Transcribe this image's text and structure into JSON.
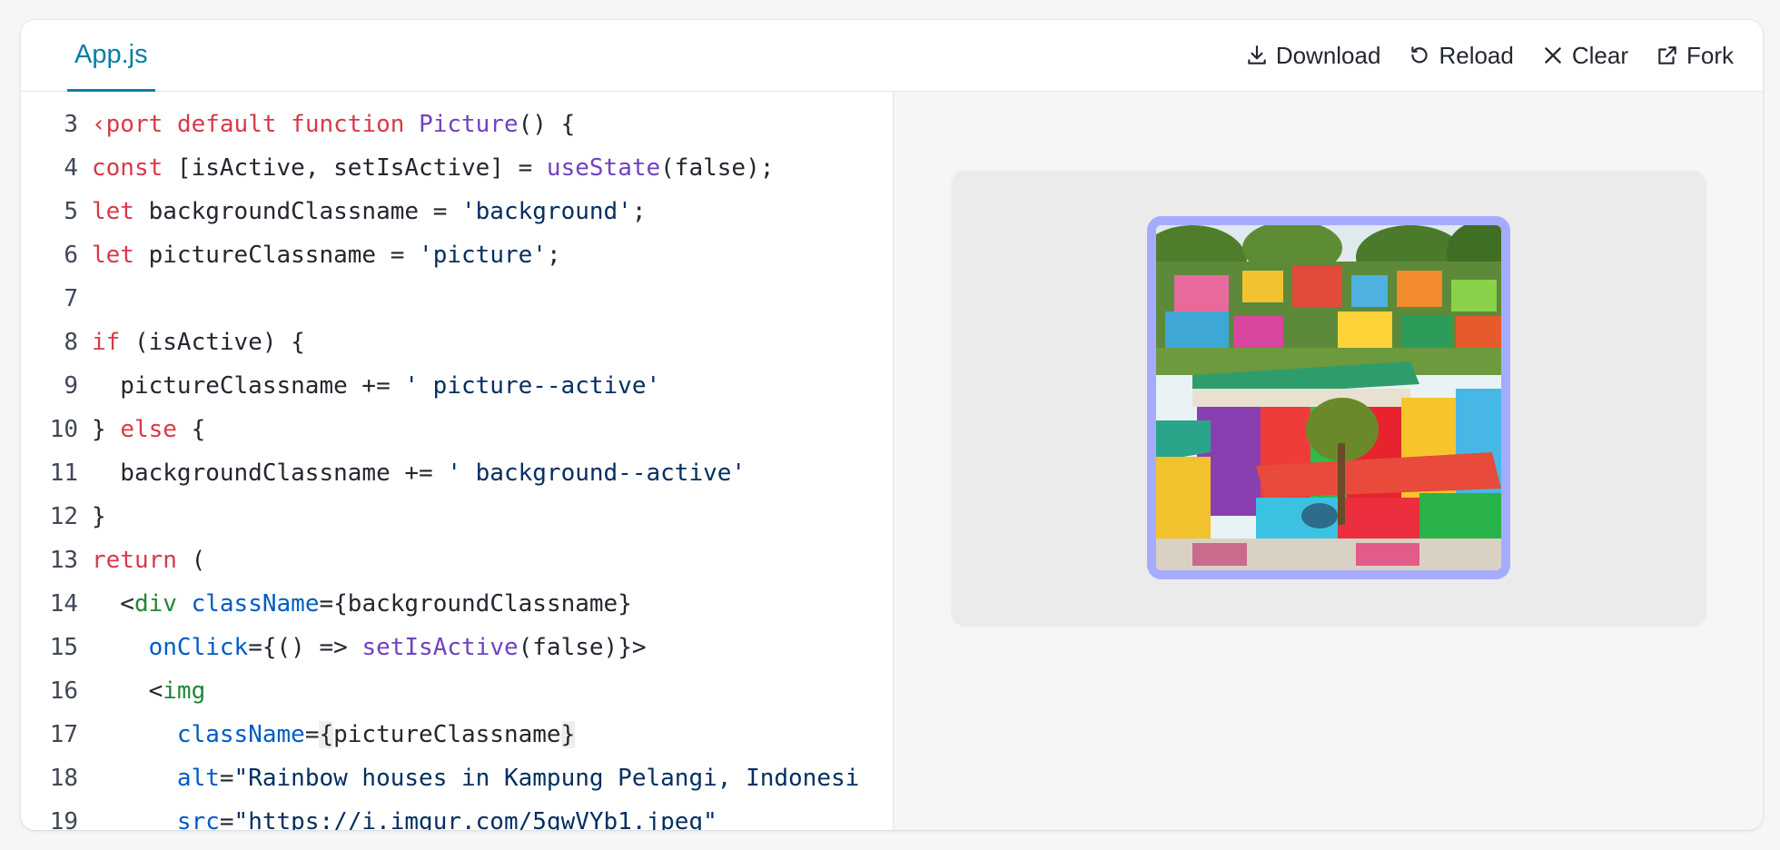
{
  "tab": {
    "filename": "App.js"
  },
  "toolbar": {
    "download": "Download",
    "reload": "Reload",
    "clear": "Clear",
    "fork": "Fork"
  },
  "code": {
    "lines": [
      {
        "n": "3",
        "tokens": [
          {
            "t": "‹port",
            "c": "kw"
          },
          {
            "t": " "
          },
          {
            "t": "default",
            "c": "kw"
          },
          {
            "t": " "
          },
          {
            "t": "function",
            "c": "kw"
          },
          {
            "t": " "
          },
          {
            "t": "Picture",
            "c": "fn"
          },
          {
            "t": "() {"
          }
        ]
      },
      {
        "n": "4",
        "tokens": [
          {
            "t": "const",
            "c": "kw"
          },
          {
            "t": " [isActive, setIsActive] = "
          },
          {
            "t": "useState",
            "c": "fn"
          },
          {
            "t": "(false);"
          }
        ]
      },
      {
        "n": "5",
        "tokens": [
          {
            "t": "let",
            "c": "kw"
          },
          {
            "t": " backgroundClassname = "
          },
          {
            "t": "'background'",
            "c": "str"
          },
          {
            "t": ";"
          }
        ]
      },
      {
        "n": "6",
        "tokens": [
          {
            "t": "let",
            "c": "kw"
          },
          {
            "t": " pictureClassname = "
          },
          {
            "t": "'picture'",
            "c": "str"
          },
          {
            "t": ";"
          }
        ]
      },
      {
        "n": "7",
        "tokens": []
      },
      {
        "n": "8",
        "tokens": [
          {
            "t": "if",
            "c": "kw"
          },
          {
            "t": " (isActive) {"
          }
        ]
      },
      {
        "n": "9",
        "tokens": [
          {
            "t": "  pictureClassname += "
          },
          {
            "t": "' picture--active'",
            "c": "str"
          }
        ]
      },
      {
        "n": "10",
        "tokens": [
          {
            "t": "} "
          },
          {
            "t": "else",
            "c": "kw"
          },
          {
            "t": " {"
          }
        ]
      },
      {
        "n": "11",
        "tokens": [
          {
            "t": "  backgroundClassname += "
          },
          {
            "t": "' background--active'",
            "c": "str"
          }
        ]
      },
      {
        "n": "12",
        "tokens": [
          {
            "t": "}"
          }
        ]
      },
      {
        "n": "13",
        "tokens": [
          {
            "t": "return",
            "c": "kw"
          },
          {
            "t": " ("
          }
        ]
      },
      {
        "n": "14",
        "tokens": [
          {
            "t": "  <"
          },
          {
            "t": "div",
            "c": "tag"
          },
          {
            "t": " "
          },
          {
            "t": "className",
            "c": "attr"
          },
          {
            "t": "={backgroundClassname}"
          }
        ]
      },
      {
        "n": "15",
        "tokens": [
          {
            "t": "    "
          },
          {
            "t": "onClick",
            "c": "attr"
          },
          {
            "t": "={() => "
          },
          {
            "t": "setIsActive",
            "c": "fn"
          },
          {
            "t": "(false)}>"
          }
        ]
      },
      {
        "n": "16",
        "tokens": [
          {
            "t": "    <"
          },
          {
            "t": "img",
            "c": "tag"
          }
        ]
      },
      {
        "n": "17",
        "tokens": [
          {
            "t": "      "
          },
          {
            "t": "className",
            "c": "attr"
          },
          {
            "t": "="
          },
          {
            "t": "{",
            "c": "hl"
          },
          {
            "t": "pictureClassname"
          },
          {
            "t": "}",
            "c": "hl"
          }
        ]
      },
      {
        "n": "18",
        "tokens": [
          {
            "t": "      "
          },
          {
            "t": "alt",
            "c": "attr"
          },
          {
            "t": "="
          },
          {
            "t": "\"Rainbow houses in Kampung Pelangi, Indonesi",
            "c": "str"
          }
        ]
      },
      {
        "n": "19",
        "tokens": [
          {
            "t": "      "
          },
          {
            "t": "src",
            "c": "attr"
          },
          {
            "t": "="
          },
          {
            "t": "\"https://i.imgur.com/5qwVYb1.jpeg\"",
            "c": "str"
          }
        ]
      }
    ]
  },
  "preview": {
    "image_subject": "rainbow-houses-photo",
    "frame_color": "#a5acff",
    "panel_color": "#ebebeb"
  },
  "colors": {
    "accent": "#087ea4",
    "keyword": "#d73a49",
    "function": "#6f42c1",
    "string": "#032f62",
    "attribute": "#005cc5",
    "tag": "#22863a"
  }
}
